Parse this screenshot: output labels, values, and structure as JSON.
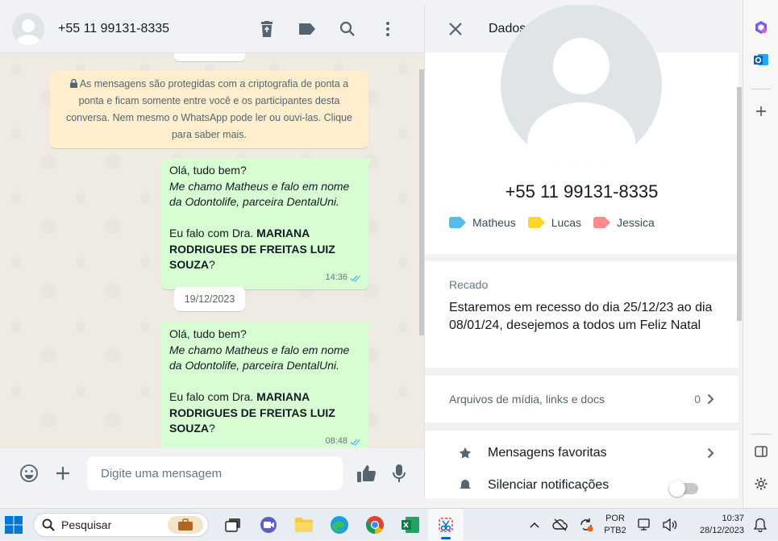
{
  "chat": {
    "title": "+55 11 99131-8335",
    "encryption_notice": "As mensagens são protegidas com a criptografia de ponta a ponta e ficam somente entre você e os participantes desta conversa. Nem mesmo o WhatsApp pode ler ou ouvi-las. Clique para saber mais.",
    "messages": [
      {
        "line1": "Olá, tudo bem?",
        "line2": "Me chamo Matheus e falo em nome da Odontolife, parceira DentalUni.",
        "line3_prefix": "Eu falo com Dra. ",
        "line3_bold": "MARIANA RODRIGUES DE FREITAS LUIZ SOUZA",
        "line3_suffix": "?",
        "time": "14:36"
      },
      {
        "line1": "Olá, tudo bem?",
        "line2": "Me chamo Matheus e falo em nome da Odontolife, parceira DentalUni.",
        "line3_prefix": "Eu falo com Dra. ",
        "line3_bold": "MARIANA RODRIGUES DE FREITAS LUIZ SOUZA",
        "line3_suffix": "?",
        "time": "08:48"
      }
    ],
    "date_separator": "19/12/2023",
    "composer_placeholder": "Digite uma mensagem"
  },
  "contact": {
    "panel_title": "Dados do contato",
    "phone": "+55 11 99131-8335",
    "labels": [
      {
        "name": "Matheus",
        "color": "#53bdeb"
      },
      {
        "name": "Lucas",
        "color": "#ffd429"
      },
      {
        "name": "Jessica",
        "color": "#ff8a8c"
      }
    ],
    "about_title": "Recado",
    "about_text": "Estaremos em recesso do dia 25/12/23 ao dia 08/01/24, desejemos a todos um Feliz Natal",
    "media_label": "Arquivos de mídia, links e docs",
    "media_count": "0",
    "favorites_label": "Mensagens favoritas",
    "mute_label": "Silenciar notificações"
  },
  "taskbar": {
    "search_placeholder": "Pesquisar",
    "lang_line1": "POR",
    "lang_line2": "PTB2",
    "time": "10:37",
    "date": "28/12/2023"
  },
  "colors": {
    "accent_green": "#d9fdd3",
    "notice_yellow": "#ffeecd",
    "read_ticks": "#53bdeb"
  }
}
